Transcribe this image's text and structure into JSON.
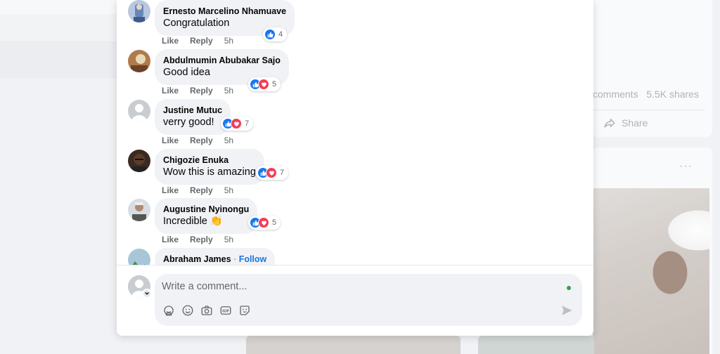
{
  "comments": [
    {
      "author": "Ernesto Marcelino Nhamuave",
      "text": "Congratulation",
      "like": "Like",
      "reply": "Reply",
      "time": "5h",
      "reaction_count": "4",
      "reactions": [
        "like"
      ]
    },
    {
      "author": "Abdulmumin Abubakar Sajo",
      "text": "Good idea",
      "like": "Like",
      "reply": "Reply",
      "time": "5h",
      "reaction_count": "5",
      "reactions": [
        "like",
        "love"
      ]
    },
    {
      "author": "Justine Mutuc",
      "text": "verry good!",
      "like": "Like",
      "reply": "Reply",
      "time": "5h",
      "reaction_count": "7",
      "reactions": [
        "like",
        "love"
      ]
    },
    {
      "author": "Chigozie Enuka",
      "text": "Wow this is amazing",
      "like": "Like",
      "reply": "Reply",
      "time": "5h",
      "reaction_count": "7",
      "reactions": [
        "like",
        "love"
      ]
    },
    {
      "author": "Augustine Nyinongu",
      "text": "Incredible",
      "emoji": "👏",
      "like": "Like",
      "reply": "Reply",
      "time": "5h",
      "reaction_count": "5",
      "reactions": [
        "like",
        "love"
      ]
    },
    {
      "author": "Abraham James",
      "follow_separator": " · ",
      "follow": "Follow"
    }
  ],
  "composer": {
    "placeholder": "Write a comment..."
  },
  "background": {
    "comments_label": "comments",
    "shares_label": "5.5K shares",
    "share_button": "Share",
    "more_dots": "···"
  },
  "colors": {
    "accent": "#1877f2",
    "love": "#f33e58",
    "online": "#31a24c",
    "bubble": "#f0f2f5"
  },
  "icons": [
    "avatar-sticker-icon",
    "emoji-icon",
    "camera-icon",
    "gif-icon",
    "sticker-icon",
    "send-icon",
    "like-reaction-icon",
    "love-reaction-icon"
  ]
}
